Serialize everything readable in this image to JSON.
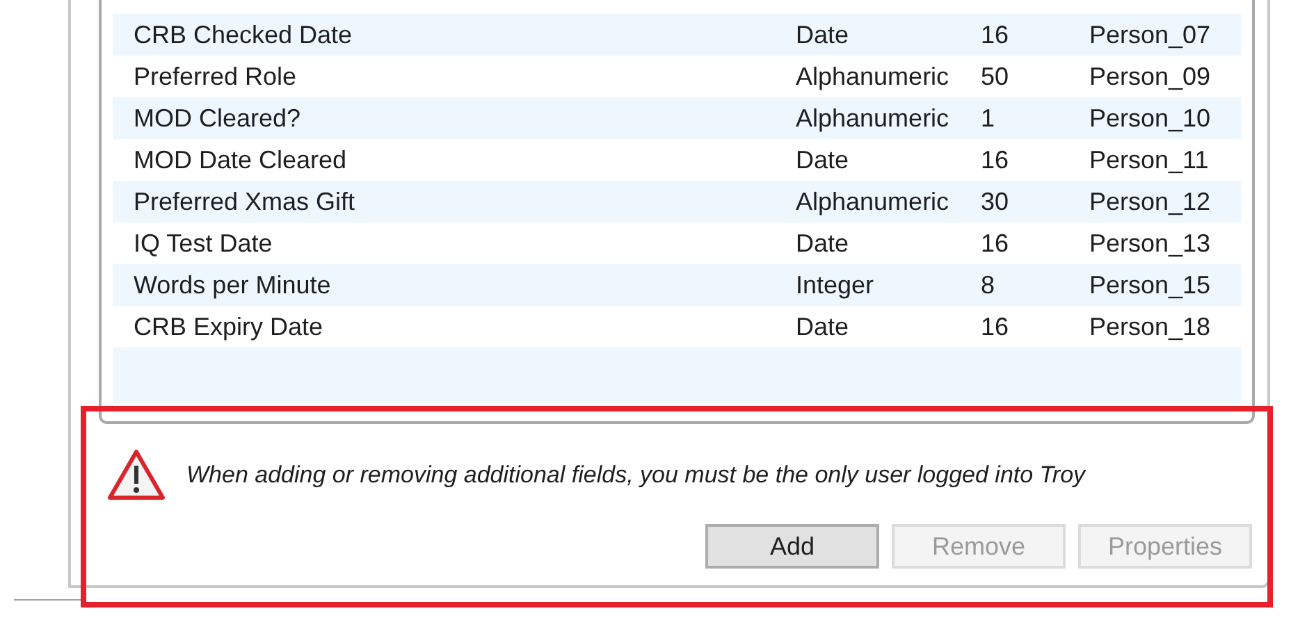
{
  "fields_table": {
    "rows": [
      {
        "name": "CRB Checked Date",
        "type": "Date",
        "length": "16",
        "column": "Person_07"
      },
      {
        "name": "Preferred Role",
        "type": "Alphanumeric",
        "length": "50",
        "column": "Person_09"
      },
      {
        "name": "MOD Cleared?",
        "type": "Alphanumeric",
        "length": "1",
        "column": "Person_10"
      },
      {
        "name": "MOD Date Cleared",
        "type": "Date",
        "length": "16",
        "column": "Person_11"
      },
      {
        "name": "Preferred Xmas Gift",
        "type": "Alphanumeric",
        "length": "30",
        "column": "Person_12"
      },
      {
        "name": "IQ Test Date",
        "type": "Date",
        "length": "16",
        "column": "Person_13"
      },
      {
        "name": "Words per Minute",
        "type": "Integer",
        "length": "8",
        "column": "Person_15"
      },
      {
        "name": "CRB Expiry Date",
        "type": "Date",
        "length": "16",
        "column": "Person_18"
      }
    ]
  },
  "warning": {
    "text": "When adding or removing additional fields, you must be the only user logged into Troy"
  },
  "buttons": [
    {
      "label": "Add",
      "disabled": false
    },
    {
      "label": "Remove",
      "disabled": true
    },
    {
      "label": "Properties",
      "disabled": true
    }
  ]
}
